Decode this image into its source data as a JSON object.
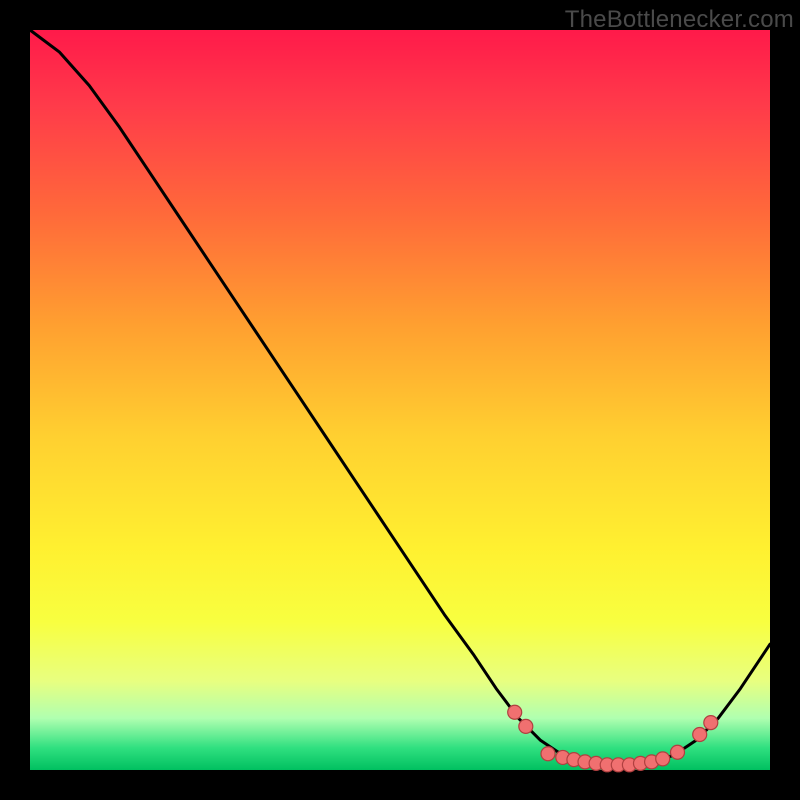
{
  "attribution": "TheBottlenecker.com",
  "chart_data": {
    "type": "line",
    "title": "",
    "xlabel": "",
    "ylabel": "",
    "xlim": [
      0,
      100
    ],
    "ylim": [
      0,
      100
    ],
    "axes_visible": false,
    "background": "rainbow-vertical-gradient",
    "curve": [
      {
        "x": 0,
        "y": 100
      },
      {
        "x": 4,
        "y": 97
      },
      {
        "x": 8,
        "y": 92.5
      },
      {
        "x": 12,
        "y": 87
      },
      {
        "x": 16,
        "y": 81
      },
      {
        "x": 20,
        "y": 75
      },
      {
        "x": 24,
        "y": 69
      },
      {
        "x": 28,
        "y": 63
      },
      {
        "x": 32,
        "y": 57
      },
      {
        "x": 36,
        "y": 51
      },
      {
        "x": 40,
        "y": 45
      },
      {
        "x": 44,
        "y": 39
      },
      {
        "x": 48,
        "y": 33
      },
      {
        "x": 52,
        "y": 27
      },
      {
        "x": 56,
        "y": 21
      },
      {
        "x": 60,
        "y": 15.5
      },
      {
        "x": 63,
        "y": 11
      },
      {
        "x": 66,
        "y": 7
      },
      {
        "x": 69,
        "y": 4
      },
      {
        "x": 72,
        "y": 2
      },
      {
        "x": 75,
        "y": 1
      },
      {
        "x": 78,
        "y": 0.5
      },
      {
        "x": 81,
        "y": 0.5
      },
      {
        "x": 84,
        "y": 1
      },
      {
        "x": 87,
        "y": 2
      },
      {
        "x": 90,
        "y": 4
      },
      {
        "x": 93,
        "y": 7
      },
      {
        "x": 96,
        "y": 11
      },
      {
        "x": 100,
        "y": 17
      }
    ],
    "markers": [
      {
        "x": 65.5,
        "y": 7.8
      },
      {
        "x": 67.0,
        "y": 5.9
      },
      {
        "x": 70.0,
        "y": 2.2
      },
      {
        "x": 72.0,
        "y": 1.7
      },
      {
        "x": 73.5,
        "y": 1.4
      },
      {
        "x": 75.0,
        "y": 1.1
      },
      {
        "x": 76.5,
        "y": 0.9
      },
      {
        "x": 78.0,
        "y": 0.7
      },
      {
        "x": 79.5,
        "y": 0.7
      },
      {
        "x": 81.0,
        "y": 0.7
      },
      {
        "x": 82.5,
        "y": 0.9
      },
      {
        "x": 84.0,
        "y": 1.1
      },
      {
        "x": 85.5,
        "y": 1.5
      },
      {
        "x": 87.5,
        "y": 2.4
      },
      {
        "x": 90.5,
        "y": 4.8
      },
      {
        "x": 92.0,
        "y": 6.4
      }
    ],
    "marker_style": {
      "fill": "#f07070",
      "stroke": "#b04040",
      "r": 7
    }
  }
}
